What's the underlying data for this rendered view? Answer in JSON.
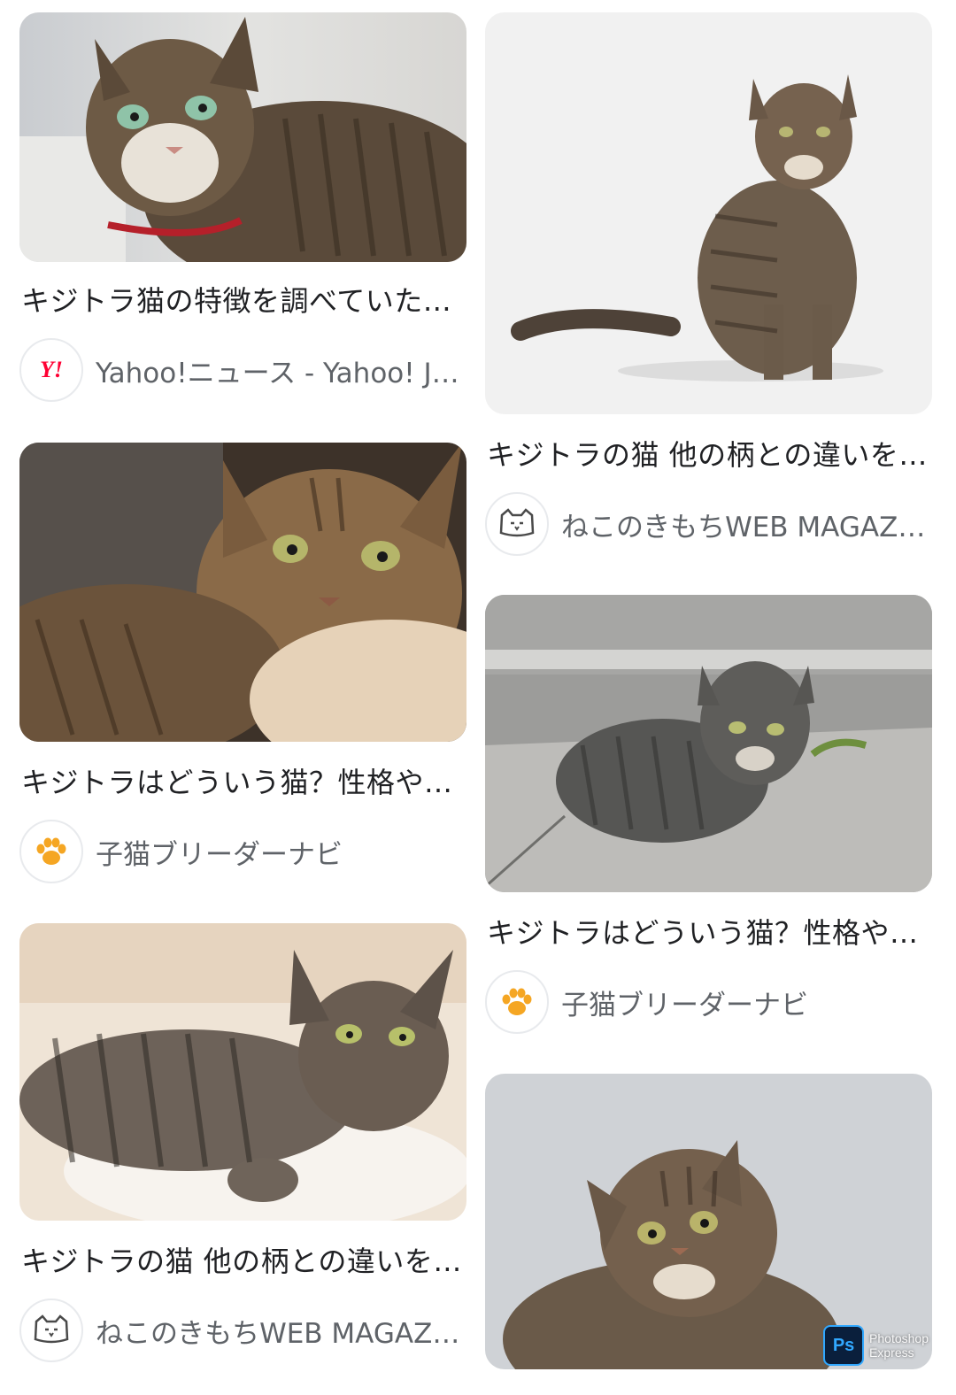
{
  "results": {
    "left": [
      {
        "title": "キジトラ猫の特徴を調べていた…",
        "source": "Yahoo!ニュース - Yahoo! J…",
        "favicon": "yahoo-icon"
      },
      {
        "title": "キジトラはどういう猫？性格や…",
        "source": "子猫ブリーダーナビ",
        "favicon": "paw-icon"
      },
      {
        "title": "キジトラの猫 他の柄との違いを…",
        "source": "ねこのきもちWEB MAGAZI…",
        "favicon": "cat-face-icon"
      }
    ],
    "right": [
      {
        "title": "キジトラの猫 他の柄との違いを…",
        "source": "ねこのきもちWEB MAGAZI…",
        "favicon": "cat-face-icon"
      },
      {
        "title": "キジトラはどういう猫？性格や…",
        "source": "子猫ブリーダーナビ",
        "favicon": "paw-icon"
      },
      {
        "title": "",
        "source": "",
        "favicon": ""
      }
    ]
  },
  "favicons": {
    "yahoo_text": "Y!"
  },
  "watermark": {
    "logo": "Ps",
    "line1": "Photoshop",
    "line2": "Express"
  },
  "colors": {
    "title_text": "#202124",
    "source_text": "#5f6368",
    "yahoo_red": "#ff0033",
    "paw_orange": "#f5a623"
  }
}
